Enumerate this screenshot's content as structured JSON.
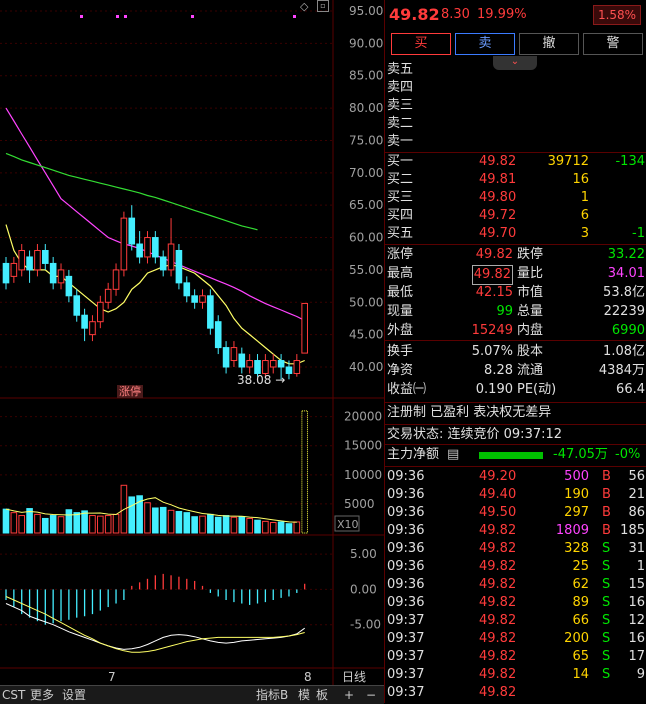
{
  "quote": {
    "price": "49.82",
    "change": "8.30",
    "pct": "19.99%",
    "turnover_badge": "1.58%"
  },
  "buttons": {
    "buy": "买",
    "sell": "卖",
    "cancel": "撤",
    "alert": "警"
  },
  "ask_labels": [
    "卖五",
    "卖四",
    "卖三",
    "卖二",
    "卖一"
  ],
  "bids": [
    {
      "label": "买一",
      "price": "49.82",
      "vol": "39712",
      "chg": "-134"
    },
    {
      "label": "买二",
      "price": "49.81",
      "vol": "16",
      "chg": ""
    },
    {
      "label": "买三",
      "price": "49.80",
      "vol": "1",
      "chg": ""
    },
    {
      "label": "买四",
      "price": "49.72",
      "vol": "6",
      "chg": ""
    },
    {
      "label": "买五",
      "price": "49.70",
      "vol": "3",
      "chg": "-1"
    }
  ],
  "stats": [
    {
      "l1": "涨停",
      "v1": "49.82",
      "l2": "跌停",
      "v2": "33.22"
    },
    {
      "l1": "最高",
      "v1": "49.82",
      "l2": "量比",
      "v2": "34.01"
    },
    {
      "l1": "最低",
      "v1": "42.15",
      "l2": "市值",
      "v2": "53.8亿"
    },
    {
      "l1": "现量",
      "v1": "99",
      "l2": "总量",
      "v2": "22239"
    },
    {
      "l1": "外盘",
      "v1": "15249",
      "l2": "内盘",
      "v2": "6990"
    }
  ],
  "fund": [
    {
      "l1": "换手",
      "v1": "5.07%",
      "l2": "股本",
      "v2": "1.08亿"
    },
    {
      "l1": "净资",
      "v1": "8.28",
      "l2": "流通",
      "v2": "4384万"
    },
    {
      "l1": "收益㈠",
      "v1": "0.190",
      "l2": "PE(动)",
      "v2": "66.4"
    }
  ],
  "tags": "注册制 已盈利 表决权无差异",
  "trade_status": "交易状态: 连续竞价 09:37:12",
  "main_flow": {
    "label": "主力净额",
    "value": "-47.05万",
    "pct": "-0%"
  },
  "ticks": [
    {
      "t": "09:36",
      "p": "49.20",
      "v": "500",
      "s": "B",
      "n": "56",
      "vc": "magenta"
    },
    {
      "t": "09:36",
      "p": "49.40",
      "v": "190",
      "s": "B",
      "n": "21",
      "vc": "yellow"
    },
    {
      "t": "09:36",
      "p": "49.50",
      "v": "297",
      "s": "B",
      "n": "86",
      "vc": "yellow"
    },
    {
      "t": "09:36",
      "p": "49.82",
      "v": "1809",
      "s": "B",
      "n": "185",
      "vc": "magenta"
    },
    {
      "t": "09:36",
      "p": "49.82",
      "v": "328",
      "s": "S",
      "n": "31",
      "vc": "yellow"
    },
    {
      "t": "09:36",
      "p": "49.82",
      "v": "25",
      "s": "S",
      "n": "1",
      "vc": "yellow"
    },
    {
      "t": "09:36",
      "p": "49.82",
      "v": "62",
      "s": "S",
      "n": "15",
      "vc": "yellow"
    },
    {
      "t": "09:36",
      "p": "49.82",
      "v": "89",
      "s": "S",
      "n": "16",
      "vc": "yellow"
    },
    {
      "t": "09:37",
      "p": "49.82",
      "v": "66",
      "s": "S",
      "n": "12",
      "vc": "yellow"
    },
    {
      "t": "09:37",
      "p": "49.82",
      "v": "200",
      "s": "S",
      "n": "16",
      "vc": "yellow"
    },
    {
      "t": "09:37",
      "p": "49.82",
      "v": "65",
      "s": "S",
      "n": "17",
      "vc": "yellow"
    },
    {
      "t": "09:37",
      "p": "49.82",
      "v": "14",
      "s": "S",
      "n": "9",
      "vc": "yellow"
    },
    {
      "t": "09:37",
      "p": "49.82",
      "v": "",
      "s": "",
      "n": "",
      "vc": "yellow"
    }
  ],
  "chart_data": {
    "type": "candlestick",
    "price_axis": [
      "95.00",
      "90.00",
      "85.00",
      "80.00",
      "75.00",
      "70.00",
      "65.00",
      "60.00",
      "55.00",
      "50.00",
      "45.00",
      "40.00"
    ],
    "volume_axis": [
      "20000",
      "15000",
      "10000",
      "5000",
      "X10"
    ],
    "macd_axis": [
      "5.00",
      "0.00",
      "-5.00"
    ],
    "low_label": "38.08",
    "limit_up_label": "涨停",
    "date_labels": [
      "7",
      "8"
    ],
    "candles": [
      {
        "o": 56,
        "c": 53,
        "h": 57,
        "l": 52
      },
      {
        "o": 54,
        "c": 56,
        "h": 57,
        "l": 53
      },
      {
        "o": 55,
        "c": 58,
        "h": 59,
        "l": 54
      },
      {
        "o": 57,
        "c": 55,
        "h": 58,
        "l": 53
      },
      {
        "o": 55,
        "c": 58,
        "h": 59,
        "l": 54
      },
      {
        "o": 58,
        "c": 56,
        "h": 59,
        "l": 55
      },
      {
        "o": 56,
        "c": 53,
        "h": 57,
        "l": 52
      },
      {
        "o": 53,
        "c": 55,
        "h": 56,
        "l": 52
      },
      {
        "o": 54,
        "c": 51,
        "h": 55,
        "l": 50
      },
      {
        "o": 51,
        "c": 48,
        "h": 52,
        "l": 47
      },
      {
        "o": 48,
        "c": 46,
        "h": 49,
        "l": 44
      },
      {
        "o": 45,
        "c": 47,
        "h": 48,
        "l": 44
      },
      {
        "o": 47,
        "c": 50,
        "h": 51,
        "l": 46
      },
      {
        "o": 50,
        "c": 52,
        "h": 53,
        "l": 49
      },
      {
        "o": 52,
        "c": 55,
        "h": 56,
        "l": 51
      },
      {
        "o": 55,
        "c": 63,
        "h": 64,
        "l": 54
      },
      {
        "o": 63,
        "c": 59,
        "h": 65,
        "l": 58
      },
      {
        "o": 59,
        "c": 57,
        "h": 61,
        "l": 56
      },
      {
        "o": 57,
        "c": 60,
        "h": 61,
        "l": 56
      },
      {
        "o": 60,
        "c": 57,
        "h": 61,
        "l": 56
      },
      {
        "o": 57,
        "c": 55,
        "h": 58,
        "l": 54
      },
      {
        "o": 55,
        "c": 59,
        "h": 63,
        "l": 54
      },
      {
        "o": 58,
        "c": 53,
        "h": 59,
        "l": 52
      },
      {
        "o": 53,
        "c": 51,
        "h": 54,
        "l": 50
      },
      {
        "o": 51,
        "c": 50,
        "h": 52,
        "l": 49
      },
      {
        "o": 50,
        "c": 51,
        "h": 52,
        "l": 49
      },
      {
        "o": 51,
        "c": 46,
        "h": 52,
        "l": 45
      },
      {
        "o": 47,
        "c": 43,
        "h": 48,
        "l": 42
      },
      {
        "o": 43,
        "c": 40,
        "h": 44,
        "l": 39
      },
      {
        "o": 41,
        "c": 43,
        "h": 44,
        "l": 40
      },
      {
        "o": 42,
        "c": 40,
        "h": 43,
        "l": 39
      },
      {
        "o": 40,
        "c": 41,
        "h": 42,
        "l": 39
      },
      {
        "o": 41,
        "c": 39,
        "h": 42,
        "l": 38.5
      },
      {
        "o": 39,
        "c": 41,
        "h": 42,
        "l": 38.5
      },
      {
        "o": 40,
        "c": 41,
        "h": 42,
        "l": 39
      },
      {
        "o": 41,
        "c": 40,
        "h": 42,
        "l": 38.08
      },
      {
        "o": 40,
        "c": 39,
        "h": 41,
        "l": 38.1
      },
      {
        "o": 39,
        "c": 41,
        "h": 42,
        "l": 38.5
      },
      {
        "o": 42.15,
        "c": 49.82,
        "h": 49.82,
        "l": 42.15
      }
    ],
    "ma": [
      {
        "color": "#ffff66",
        "values": [
          62,
          58,
          56,
          55,
          55,
          55,
          54,
          54,
          53,
          52,
          51,
          50,
          49,
          48.5,
          49,
          50,
          52,
          53,
          54.5,
          55,
          55.5,
          55.8,
          55.5,
          55,
          54.5,
          53.5,
          52.5,
          51,
          49.5,
          47.5,
          46,
          45,
          44,
          43,
          42,
          41,
          40.5,
          40.5,
          41
        ]
      },
      {
        "color": "#ff44ff",
        "values": [
          80,
          78,
          76,
          74,
          72,
          70,
          68,
          66,
          65,
          64,
          63,
          62,
          61,
          60,
          59.5,
          59,
          58.7,
          58.3,
          57.8,
          57.3,
          56.8,
          56.3,
          55.8,
          55.3,
          54.8,
          54.3,
          53.8,
          53.3,
          52.8,
          52.3,
          51.7,
          51,
          50.4,
          49.8,
          49.3,
          48.8,
          48.3,
          47.8,
          47.2
        ]
      },
      {
        "color": "#33dd33",
        "values": [
          73,
          72.5,
          72,
          71.6,
          71.2,
          70.8,
          70.4,
          70,
          69.6,
          69.3,
          69,
          68.7,
          68.4,
          68.1,
          67.8,
          67.5,
          67.2,
          66.9,
          66.5,
          66.2,
          65.8,
          65.4,
          65,
          64.6,
          64.2,
          63.8,
          63.4,
          63,
          62.6,
          62.2,
          61.8,
          61.5,
          61.2
        ]
      }
    ],
    "volume": [
      4100,
      3500,
      3000,
      4200,
      3200,
      2500,
      3000,
      2800,
      4000,
      3500,
      3800,
      3000,
      2900,
      3000,
      3200,
      8200,
      6200,
      6400,
      5200,
      4300,
      4400,
      3900,
      3700,
      3500,
      2800,
      2900,
      3200,
      2700,
      3000,
      2700,
      2800,
      2500,
      2200,
      2000,
      1800,
      1900,
      1600,
      1900,
      21000
    ],
    "macd": [
      -1.5,
      -2.5,
      -3.5,
      -4,
      -4.5,
      -5,
      -4.8,
      -4.5,
      -4.3,
      -4.0,
      -3.8,
      -3.5,
      -3.0,
      -2.5,
      -2,
      -1.5,
      0.5,
      1,
      1.5,
      2,
      2.2,
      2,
      1.8,
      1.5,
      1.2,
      0.5,
      -0.5,
      -1,
      -1.5,
      -1.8,
      -2,
      -2.2,
      -2,
      -1.8,
      -1.5,
      -1.2,
      -1,
      -0.5,
      0.8
    ],
    "dif": [
      -2,
      -2.5,
      -3,
      -3.8,
      -4.2,
      -4.6,
      -5,
      -5.5,
      -6,
      -6.4,
      -6.8,
      -7.2,
      -7.6,
      -8,
      -8.3,
      -8.5,
      -8.4,
      -8.2,
      -7.8,
      -7.3,
      -6.8,
      -6.5,
      -6.4,
      -6.5,
      -6.7,
      -7,
      -7.3,
      -7.5,
      -7.6,
      -7.5,
      -7.3,
      -7.2,
      -7.1,
      -7,
      -6.9,
      -6.8,
      -6.6,
      -6.3,
      -5.5
    ],
    "dea": [
      -1,
      -1.5,
      -2,
      -2.5,
      -3,
      -3.5,
      -4.1,
      -4.7,
      -5.3,
      -5.9,
      -6.5,
      -7,
      -7.6,
      -8,
      -8.4,
      -8.7,
      -8.9,
      -8.9,
      -8.8,
      -8.6,
      -8.3,
      -8,
      -7.7,
      -7.4,
      -7.2,
      -7,
      -6.9,
      -6.8,
      -6.8,
      -6.8,
      -6.8,
      -6.8,
      -6.8,
      -6.8,
      -6.8,
      -6.7,
      -6.6,
      -6.4,
      -6.1
    ]
  },
  "bottom": {
    "cst": "CST",
    "more": "更多",
    "settings": "设置",
    "indicator": "指标B",
    "template": "模",
    "board": "板",
    "daily": "日线",
    "plus": "+",
    "minus": "−"
  }
}
